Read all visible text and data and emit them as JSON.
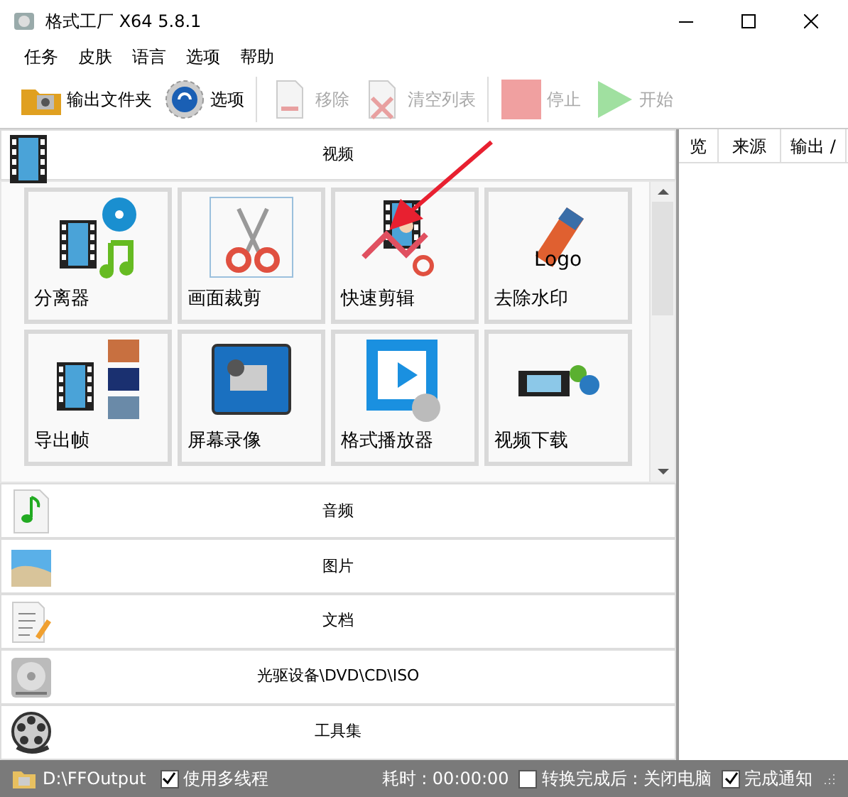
{
  "window": {
    "title": "格式工厂 X64 5.8.1"
  },
  "menu": [
    {
      "label": "任务"
    },
    {
      "label": "皮肤"
    },
    {
      "label": "语言"
    },
    {
      "label": "选项"
    },
    {
      "label": "帮助"
    }
  ],
  "toolbar": [
    {
      "label": "输出文件夹",
      "disabled": false
    },
    {
      "label": "选项",
      "disabled": false
    },
    {
      "label": "移除",
      "disabled": true
    },
    {
      "label": "清空列表",
      "disabled": true
    },
    {
      "label": "停止",
      "disabled": true
    },
    {
      "label": "开始",
      "disabled": true
    }
  ],
  "categories": [
    {
      "label": "视频",
      "expanded": true,
      "tools": [
        {
          "label": "分离器"
        },
        {
          "label": "画面裁剪"
        },
        {
          "label": "快速剪辑"
        },
        {
          "label": "去除水印",
          "icon_text": "Logo"
        },
        {
          "label": "导出帧"
        },
        {
          "label": "屏幕录像"
        },
        {
          "label": "格式播放器"
        },
        {
          "label": "视频下载"
        }
      ]
    },
    {
      "label": "音频",
      "expanded": false
    },
    {
      "label": "图片",
      "expanded": false
    },
    {
      "label": "文档",
      "expanded": false
    },
    {
      "label": "光驱设备\\DVD\\CD\\ISO",
      "expanded": false
    },
    {
      "label": "工具集",
      "expanded": false
    }
  ],
  "task_list": {
    "columns": [
      "览",
      "来源",
      "输出 /"
    ]
  },
  "status_bar": {
    "output_folder": "D:\\FFOutput",
    "options": [
      {
        "kind": "checkbox",
        "label": "使用多线程",
        "checked": true
      },
      {
        "kind": "text",
        "label": "耗时 : 00:00:00"
      },
      {
        "kind": "checkbox",
        "label": "转换完成后 : 关闭电脑",
        "checked": false
      },
      {
        "kind": "checkbox",
        "label": "完成通知",
        "checked": true
      }
    ]
  }
}
